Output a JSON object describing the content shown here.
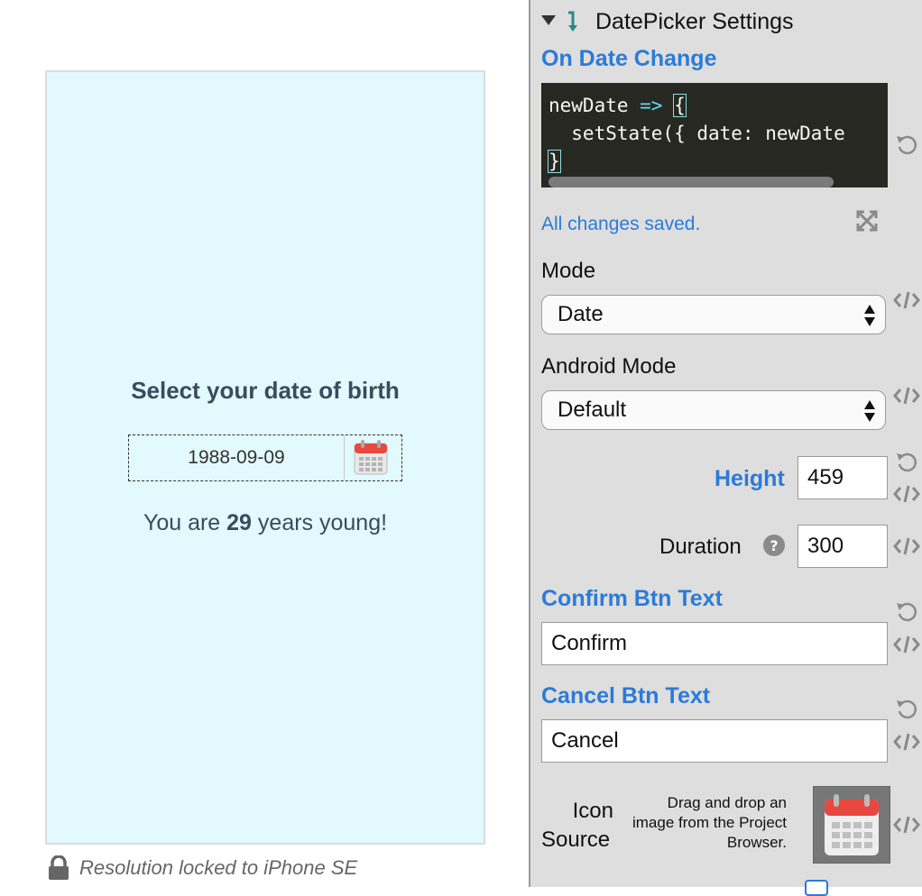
{
  "preview": {
    "title": "Select your date of birth",
    "date_value": "1988-09-09",
    "age_prefix": "You are ",
    "age_value": "29",
    "age_suffix": " years young!",
    "background": "#e2f9fd",
    "resolution_note": "Resolution locked to iPhone SE"
  },
  "panel": {
    "section_title": "DatePicker Settings",
    "on_date_change_label": "On Date Change",
    "code_lines": [
      "newDate => {",
      "  setState({ date: newDate",
      "}"
    ],
    "save_status": "All changes saved.",
    "mode_label": "Mode",
    "mode_value": "Date",
    "android_mode_label": "Android Mode",
    "android_mode_value": "Default",
    "height_label": "Height",
    "height_value": "459",
    "duration_label": "Duration",
    "duration_value": "300",
    "confirm_label": "Confirm Btn Text",
    "confirm_value": "Confirm",
    "cancel_label": "Cancel Btn Text",
    "cancel_value": "Cancel",
    "icon_source_label_1": "Icon",
    "icon_source_label_2": "Source",
    "drag_hint_1": "Drag and drop an",
    "drag_hint_2": "image from the Project",
    "drag_hint_3": "Browser.",
    "accent_color": "#2b7bd8"
  },
  "icons": [
    "caret-down-icon",
    "arrow-down-icon",
    "undo-icon",
    "expand-icon",
    "code-icon",
    "help-icon",
    "calendar-icon",
    "lock-icon",
    "select-arrows-icon"
  ]
}
